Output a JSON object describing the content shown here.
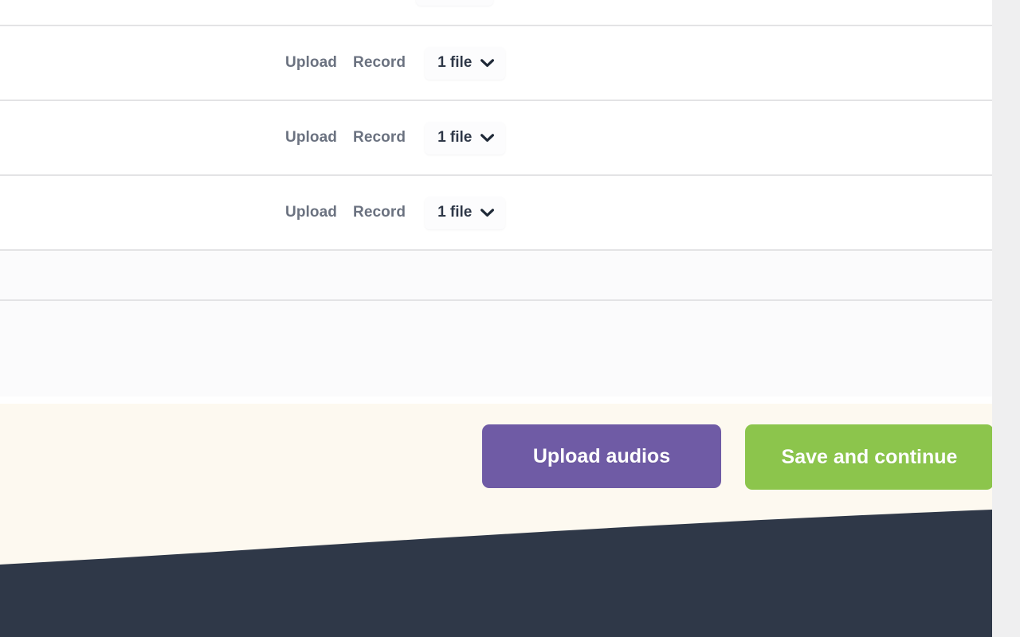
{
  "colors": {
    "purple_button": "#6f5ba5",
    "green_button": "#8cc54c",
    "cream_bar": "#fdf9f0",
    "footer_navy": "#2f3848",
    "divider": "#e3e3e5",
    "grey_band": "#fbfbfc",
    "action_link_text": "#6b7280",
    "select_text": "#2f3848",
    "scrollbar_track": "#efeff0"
  },
  "upload_table": {
    "rows": [
      {
        "upload_label": "Upload",
        "record_label": "Record",
        "file_count_label": "1 file",
        "chevron_icon": "chevron-down-icon"
      },
      {
        "upload_label": "Upload",
        "record_label": "Record",
        "file_count_label": "1 file",
        "chevron_icon": "chevron-down-icon"
      },
      {
        "upload_label": "Upload",
        "record_label": "Record",
        "file_count_label": "1 file",
        "chevron_icon": "chevron-down-icon"
      }
    ],
    "file_count_options": [
      "1 file"
    ]
  },
  "action_bar": {
    "upload_button_label": "Upload audios",
    "save_button_label": "Save and continue"
  },
  "scrollbar": {
    "orientation": "vertical",
    "position": "right"
  }
}
